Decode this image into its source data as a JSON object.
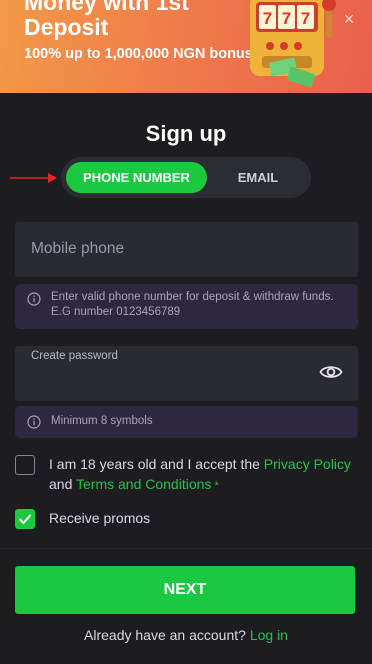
{
  "banner": {
    "title_line1": "Money with 1st",
    "title_line2": "Deposit",
    "subtitle": "100% up to 1,000,000 NGN bonus",
    "close_label": "×"
  },
  "form": {
    "title": "Sign up",
    "tabs": [
      {
        "label": "PHONE NUMBER",
        "active": true
      },
      {
        "label": "EMAIL",
        "active": false
      }
    ],
    "phone": {
      "placeholder": "Mobile phone",
      "hint": "Enter valid phone number for deposit & withdraw funds. E.G number 0123456789"
    },
    "password": {
      "label": "Create password",
      "hint": "Minimum 8 symbols"
    },
    "terms": {
      "prefix": "I am 18 years old and I accept the ",
      "privacy_link": "Privacy Policy",
      "and": " and ",
      "terms_link": "Terms and Conditions",
      "required_mark": " *",
      "checked": false
    },
    "promos": {
      "label": "Receive promos",
      "checked": true
    },
    "next_button": "NEXT",
    "account_prompt": "Already have an account? ",
    "login_link": "Log in"
  },
  "colors": {
    "accent": "#1ac93f",
    "background": "#1c1c21",
    "hint_background": "#2f2740",
    "banner_orange": "#ef7d4a",
    "arrow_red": "#e0262a"
  }
}
